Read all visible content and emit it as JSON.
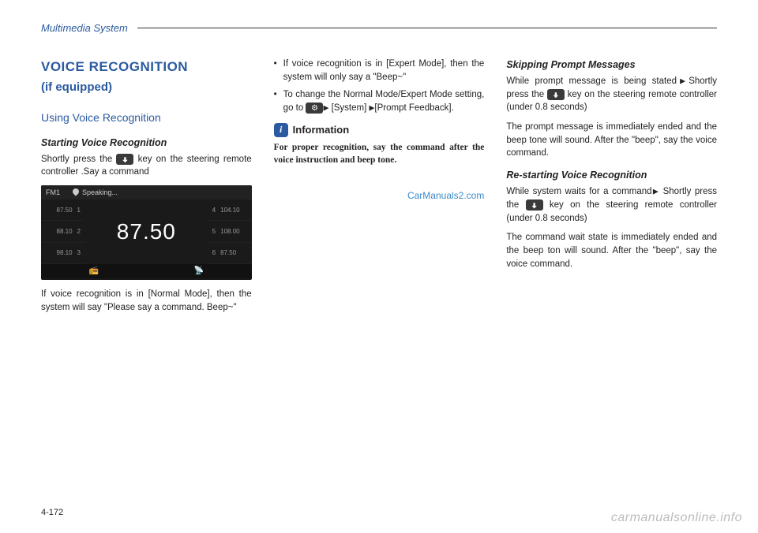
{
  "header": {
    "section": "Multimedia System"
  },
  "col1": {
    "h1": "VOICE RECOGNITION",
    "h2": "(if equipped)",
    "h3": "Using Voice Recognition",
    "starting_title": "Starting Voice Recognition",
    "starting_p1a": "Shortly press the ",
    "starting_p1b": " key on the steering remote controller .Say a command",
    "radio": {
      "band": "FM1",
      "status": "Speaking...",
      "big": "87.50",
      "presets_left": [
        {
          "n": "1",
          "f": "87.50"
        },
        {
          "n": "2",
          "f": "88.10"
        },
        {
          "n": "3",
          "f": "98.10"
        }
      ],
      "presets_right": [
        {
          "n": "4",
          "f": "104.10"
        },
        {
          "n": "5",
          "f": "108.00"
        },
        {
          "n": "6",
          "f": "87.50"
        }
      ]
    },
    "starting_p2": "If voice recognition is in [Normal Mode], then the system will say \"Please say a command. Beep~\""
  },
  "col2": {
    "bullet1": "If voice recognition is in [Expert Mode], then the system will only say a \"Beep~\"",
    "bullet2a": "To change the Normal Mode/Expert Mode setting, go to ",
    "bullet2b": " [System] ",
    "bullet2c": "[Prompt Feedback].",
    "info_label": "Information",
    "info_text": "For proper recognition, say the com­mand after the voice instruction and beep tone.",
    "watermark": "CarManuals2.com"
  },
  "col3": {
    "skip_title": "Skipping Prompt Messages",
    "skip_p1a": "While prompt message is being stat­ed",
    "skip_p1b": "Shortly press the ",
    "skip_p1c": " key on the steering remote controller (under 0.8 seconds)",
    "skip_p2": "The prompt message is immediately ended and the beep tone will sound. After the \"beep\", say the voice com­mand.",
    "restart_title": "Re-starting Voice Recognition",
    "restart_p1a": "While system waits for a command",
    "restart_p1b": " Shortly press the ",
    "restart_p1c": " key on the steering remote controller (under 0.8 seconds)",
    "restart_p2": "The command wait state is immedi­ately ended and the beep ton will sound. After the \"beep\", say the voice command."
  },
  "footer": {
    "page": "4-172",
    "watermark": "carmanualsonline.info"
  }
}
